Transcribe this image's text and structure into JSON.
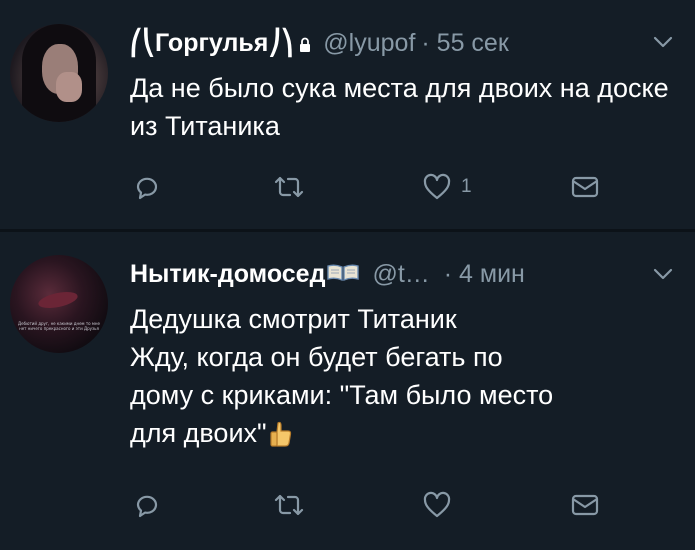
{
  "tweets": [
    {
      "name": "⎛⎝Горгулья⎠⎞",
      "handle": "@lyupof",
      "time": "· 55 сек",
      "text": "Да не было сука места для двоих на доске из Титаника",
      "likes": "1",
      "protected": true
    },
    {
      "name": "Нытик-домосед",
      "handle": "@t…",
      "time": "· 4 мин",
      "text_lines": [
        "Дедушка смотрит Титаник",
        "Жду, когда он будет бегать по",
        "дому с криками: \"Там было место",
        "для двоих\""
      ],
      "avatar_caption": "Дебютий друг, не какими днем то мне нет ничего прекрасного и эти Друзья"
    }
  ],
  "colors": {
    "background": "#141d26",
    "text": "#ffffff",
    "secondary": "#8899a6",
    "divider": "#0c1218"
  }
}
